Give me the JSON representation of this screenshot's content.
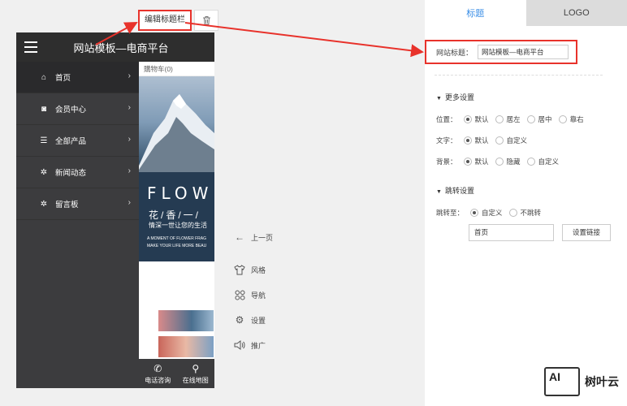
{
  "toolbar": {
    "edit_title_label": "编辑标题栏",
    "trash_icon": "trash-icon"
  },
  "phone": {
    "title": "网站模板—电商平台",
    "menu": [
      {
        "label": "首页",
        "icon": "home-icon",
        "glyph": "⌂"
      },
      {
        "label": "会员中心",
        "icon": "user-icon",
        "glyph": "◙"
      },
      {
        "label": "全部产品",
        "icon": "products-icon",
        "glyph": "☰"
      },
      {
        "label": "新闻动态",
        "icon": "gear-icon",
        "glyph": "✲"
      },
      {
        "label": "留言板",
        "icon": "gear-icon",
        "glyph": "✲"
      }
    ],
    "cart_text": "購物车(0)",
    "banner": {
      "flow": "FLOW",
      "flower": "花/香/一/",
      "life": "情深一世让您的生活",
      "en1": "A MOMENT OF FLOWER FRAG",
      "en2": "MAKE YOUR LIFE MORE BEAU"
    },
    "bottom": [
      {
        "label": "电话咨询",
        "icon": "phone-icon",
        "glyph": "✆"
      },
      {
        "label": "在线地图",
        "icon": "map-pin-icon",
        "glyph": "⚲"
      }
    ]
  },
  "middle": {
    "prev_page": "上一页",
    "style": "风格",
    "nav": "导航",
    "settings": "设置",
    "promote": "推广"
  },
  "panel": {
    "tab_title": "标题",
    "tab_logo": "LOGO",
    "site_title_label": "网站标题：",
    "site_title_value": "网站模板—电商平台",
    "more_settings": "更多设置",
    "position": {
      "label": "位置：",
      "options": [
        "默认",
        "居左",
        "居中",
        "靠右"
      ]
    },
    "text": {
      "label": "文字：",
      "options": [
        "默认",
        "自定义"
      ]
    },
    "background": {
      "label": "背景：",
      "options": [
        "默认",
        "隐藏",
        "自定义"
      ]
    },
    "jump_settings": "跳转设置",
    "jump_to": {
      "label": "跳转至：",
      "options": [
        "自定义",
        "不跳转"
      ]
    },
    "jump_value": "首页",
    "link_button": "设置链接"
  },
  "watermark": {
    "logo": "AI",
    "text": "树叶云"
  },
  "colors": {
    "highlight": "#e8322b",
    "accent": "#3a8ee6"
  }
}
